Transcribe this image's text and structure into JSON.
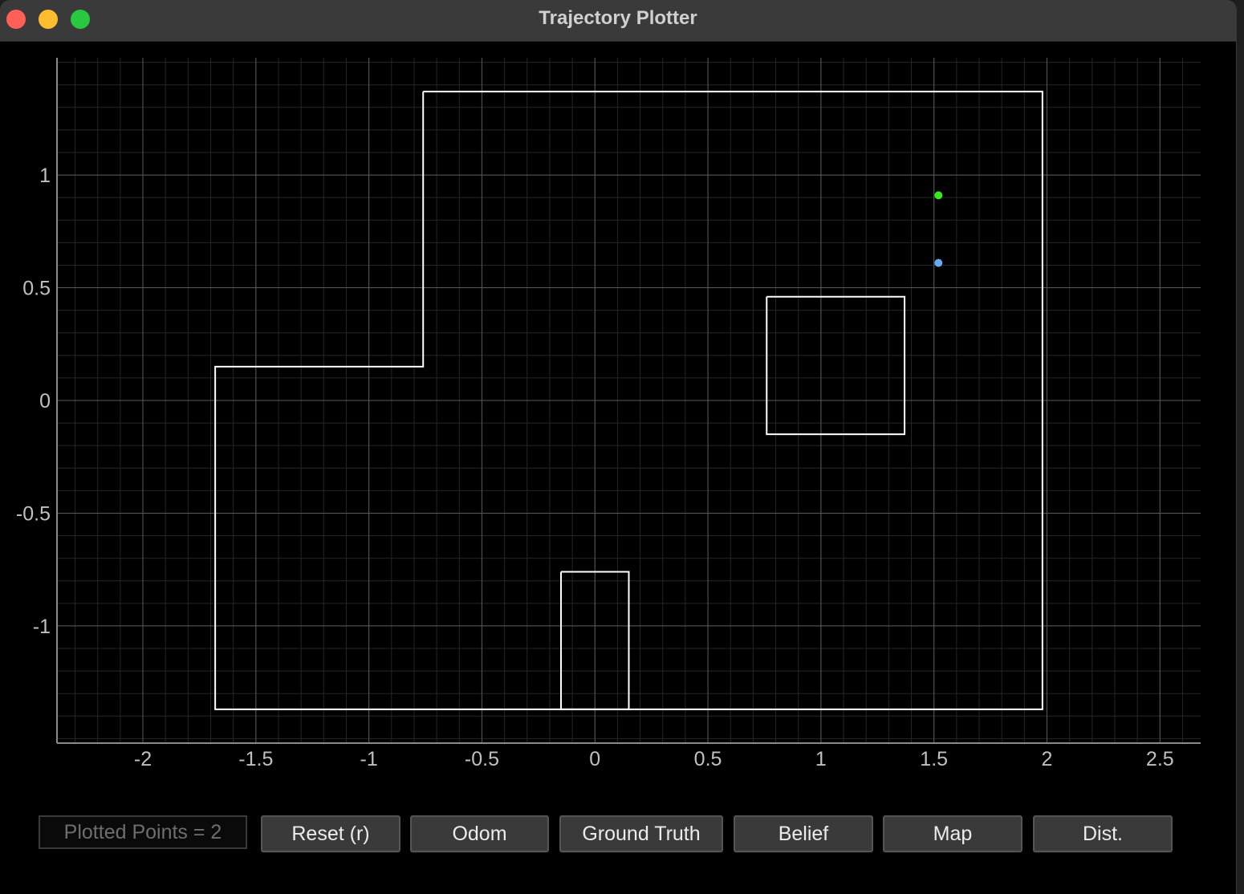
{
  "window": {
    "title": "Trajectory Plotter"
  },
  "status": {
    "plotted_points": "Plotted Points = 2"
  },
  "toolbar": {
    "buttons": [
      {
        "label": "Reset (r)"
      },
      {
        "label": "Odom"
      },
      {
        "label": "Ground Truth"
      },
      {
        "label": "Belief"
      },
      {
        "label": "Map"
      },
      {
        "label": "Dist."
      }
    ]
  },
  "chart_data": {
    "type": "scatter",
    "xlim": [
      -2.38,
      2.68
    ],
    "ylim": [
      -1.52,
      1.52
    ],
    "x_ticks": [
      -2,
      -1.5,
      -1,
      -0.5,
      0,
      0.5,
      1,
      1.5,
      2,
      2.5
    ],
    "x_tick_labels": [
      "-2",
      "-1.5",
      "-1",
      "-0.5",
      "0",
      "0.5",
      "1",
      "1.5",
      "2",
      "2.5"
    ],
    "y_ticks": [
      -1,
      -0.5,
      0,
      0.5,
      1
    ],
    "y_tick_labels": [
      "-1",
      "-0.5",
      "0",
      "0.5",
      "1"
    ],
    "grid": true,
    "minor_grid_step": 0.1,
    "map_outline": [
      [
        -0.76,
        1.37
      ],
      [
        1.98,
        1.37
      ],
      [
        1.98,
        -1.37
      ],
      [
        -1.68,
        -1.37
      ],
      [
        -1.68,
        0.15
      ],
      [
        -0.76,
        0.15
      ],
      [
        -0.76,
        1.37
      ]
    ],
    "obstacles": [
      [
        [
          0.76,
          0.46
        ],
        [
          1.37,
          0.46
        ],
        [
          1.37,
          -0.15
        ],
        [
          0.76,
          -0.15
        ],
        [
          0.76,
          0.46
        ]
      ],
      [
        [
          -0.15,
          -0.76
        ],
        [
          0.15,
          -0.76
        ],
        [
          0.15,
          -1.37
        ],
        [
          -0.15,
          -1.37
        ],
        [
          -0.15,
          -0.76
        ]
      ]
    ],
    "points": [
      {
        "x": 1.52,
        "y": 0.91,
        "color": "#39e81f"
      },
      {
        "x": 1.52,
        "y": 0.61,
        "color": "#6aa9f0"
      }
    ],
    "colors": {
      "background": "#000000",
      "map_line": "#ffffff",
      "major_grid": "#5a5a5a",
      "minor_grid": "#262626",
      "axis": "#8a8a8a",
      "tick_label": "#c0c0c0"
    }
  }
}
